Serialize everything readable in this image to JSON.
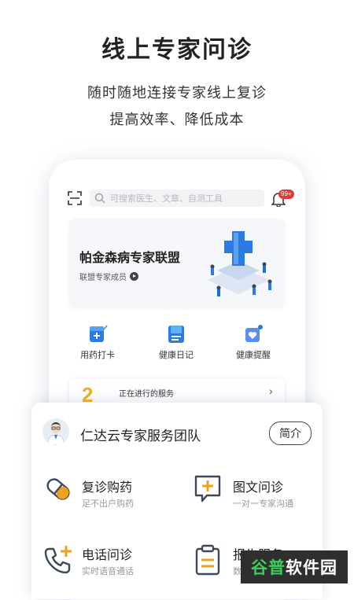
{
  "hero": {
    "title": "线上专家问诊",
    "line1": "随时随地连接专家线上复诊",
    "line2": "提高效率、降低成本"
  },
  "app": {
    "search_placeholder": "可搜索医生、文章、自测工具",
    "notification_badge": "99+",
    "banner": {
      "title": "帕金森病专家联盟",
      "subtitle": "联盟专家成员"
    },
    "quick_actions": [
      {
        "label": "用药打卡",
        "icon": "medication-checkin-icon"
      },
      {
        "label": "健康日记",
        "icon": "health-diary-icon"
      },
      {
        "label": "健康提醒",
        "icon": "health-reminder-icon"
      }
    ],
    "service": {
      "count": "2",
      "label": "正在进行的服务"
    }
  },
  "team_card": {
    "name": "仁达云专家服务团队",
    "intro_button": "简介",
    "features": [
      {
        "title": "复诊购药",
        "desc": "足不出户购药",
        "icon": "pill-icon"
      },
      {
        "title": "图文问诊",
        "desc": "一对一专家沟通",
        "icon": "chat-plus-icon"
      },
      {
        "title": "电话问诊",
        "desc": "实时语音通话",
        "icon": "phone-plus-icon"
      },
      {
        "title": "报告服务",
        "desc": "数",
        "icon": "clipboard-icon"
      }
    ]
  },
  "watermark": {
    "part1": "谷普",
    "part2": "软件园"
  },
  "colors": {
    "accent_blue": "#2a7be4",
    "accent_orange": "#f0a21a",
    "badge_red": "#e53935"
  }
}
